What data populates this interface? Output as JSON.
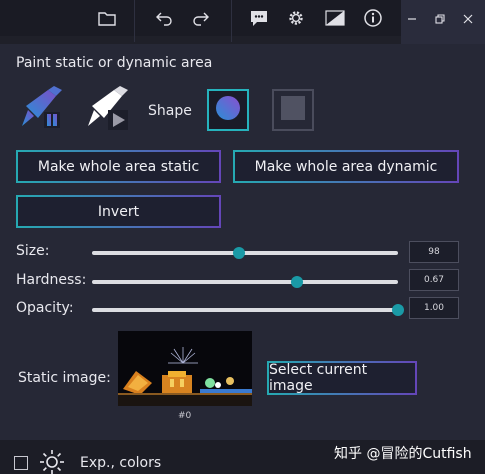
{
  "panel": {
    "title": "Paint static or dynamic area",
    "shape_label": "Shape",
    "buttons": {
      "make_static": "Make whole area static",
      "make_dynamic": "Make whole area dynamic",
      "invert": "Invert",
      "select_image": "Select current image"
    },
    "sliders": [
      {
        "label": "Size:",
        "value": "98",
        "fraction": 0.48
      },
      {
        "label": "Hardness:",
        "value": "0.67",
        "fraction": 0.67
      },
      {
        "label": "Opacity:",
        "value": "1.00",
        "fraction": 1.0
      }
    ],
    "static_image": {
      "label": "Static image:",
      "caption": "#0"
    }
  },
  "footer": {
    "label": "Exp., colors"
  },
  "watermark": "知乎 @冒险的Cutfish",
  "icons": {
    "toolbar": [
      "folder-icon",
      "undo-icon",
      "redo-icon",
      "feedback-icon",
      "settings-icon",
      "compare-icon",
      "info-icon",
      "minimize-icon",
      "restore-icon",
      "close-icon"
    ],
    "tools": [
      "static-brush-icon",
      "dynamic-brush-icon"
    ],
    "shapes": [
      "circle-shape-icon",
      "square-shape-icon"
    ],
    "footer": [
      "sun-icon"
    ]
  },
  "colors": {
    "accent": "#26b3bd",
    "accent_purple": "#5a4fa8",
    "background": "#262836"
  }
}
